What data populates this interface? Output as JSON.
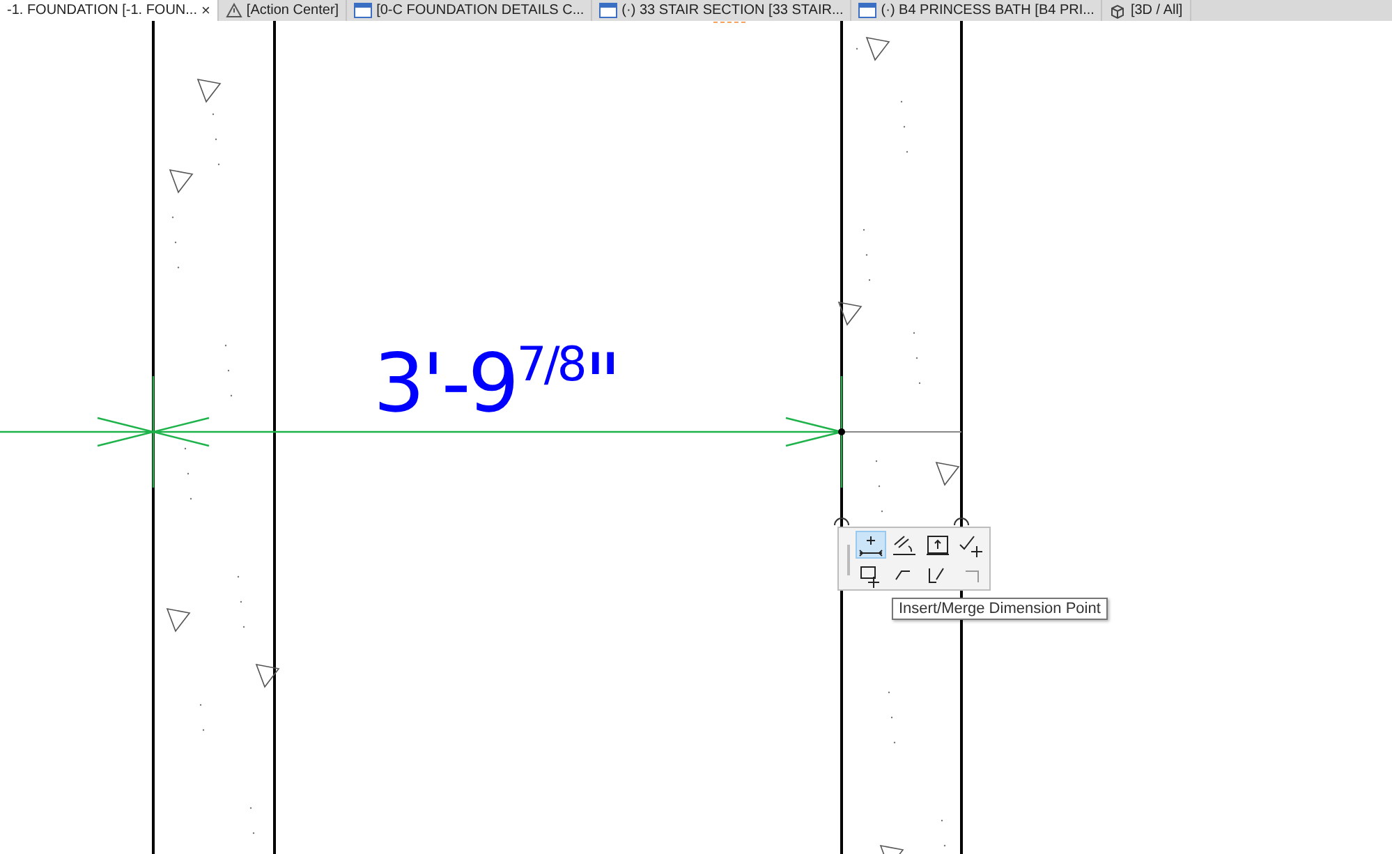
{
  "tabs": [
    {
      "label": "-1. FOUNDATION [-1. FOUN...",
      "kind": "none",
      "selected": true,
      "close": "×"
    },
    {
      "label": "[Action Center]",
      "kind": "warning",
      "selected": false
    },
    {
      "label": "[0-C FOUNDATION DETAILS C...",
      "kind": "sheet",
      "selected": false
    },
    {
      "label": "(·) 33 STAIR SECTION [33 STAIR...",
      "kind": "sheet",
      "selected": false
    },
    {
      "label": "(·) B4 PRINCESS BATH [B4 PRI...",
      "kind": "sheet",
      "selected": false
    },
    {
      "label": "[3D / All]",
      "kind": "cube",
      "selected": false
    }
  ],
  "dimension": {
    "text": "3'-9$^{7/8}$\""
  },
  "palette": {
    "tools": [
      {
        "kind": "insert",
        "selected": true
      },
      {
        "kind": "offset",
        "selected": false
      },
      {
        "kind": "elevation",
        "selected": false
      },
      {
        "kind": "check-move",
        "selected": false
      },
      {
        "kind": "move",
        "selected": false
      },
      {
        "kind": "shape",
        "selected": false
      },
      {
        "kind": "corner",
        "selected": false
      },
      {
        "kind": "square",
        "selected": false
      }
    ],
    "tooltip": "Insert/Merge Dimension Point"
  }
}
